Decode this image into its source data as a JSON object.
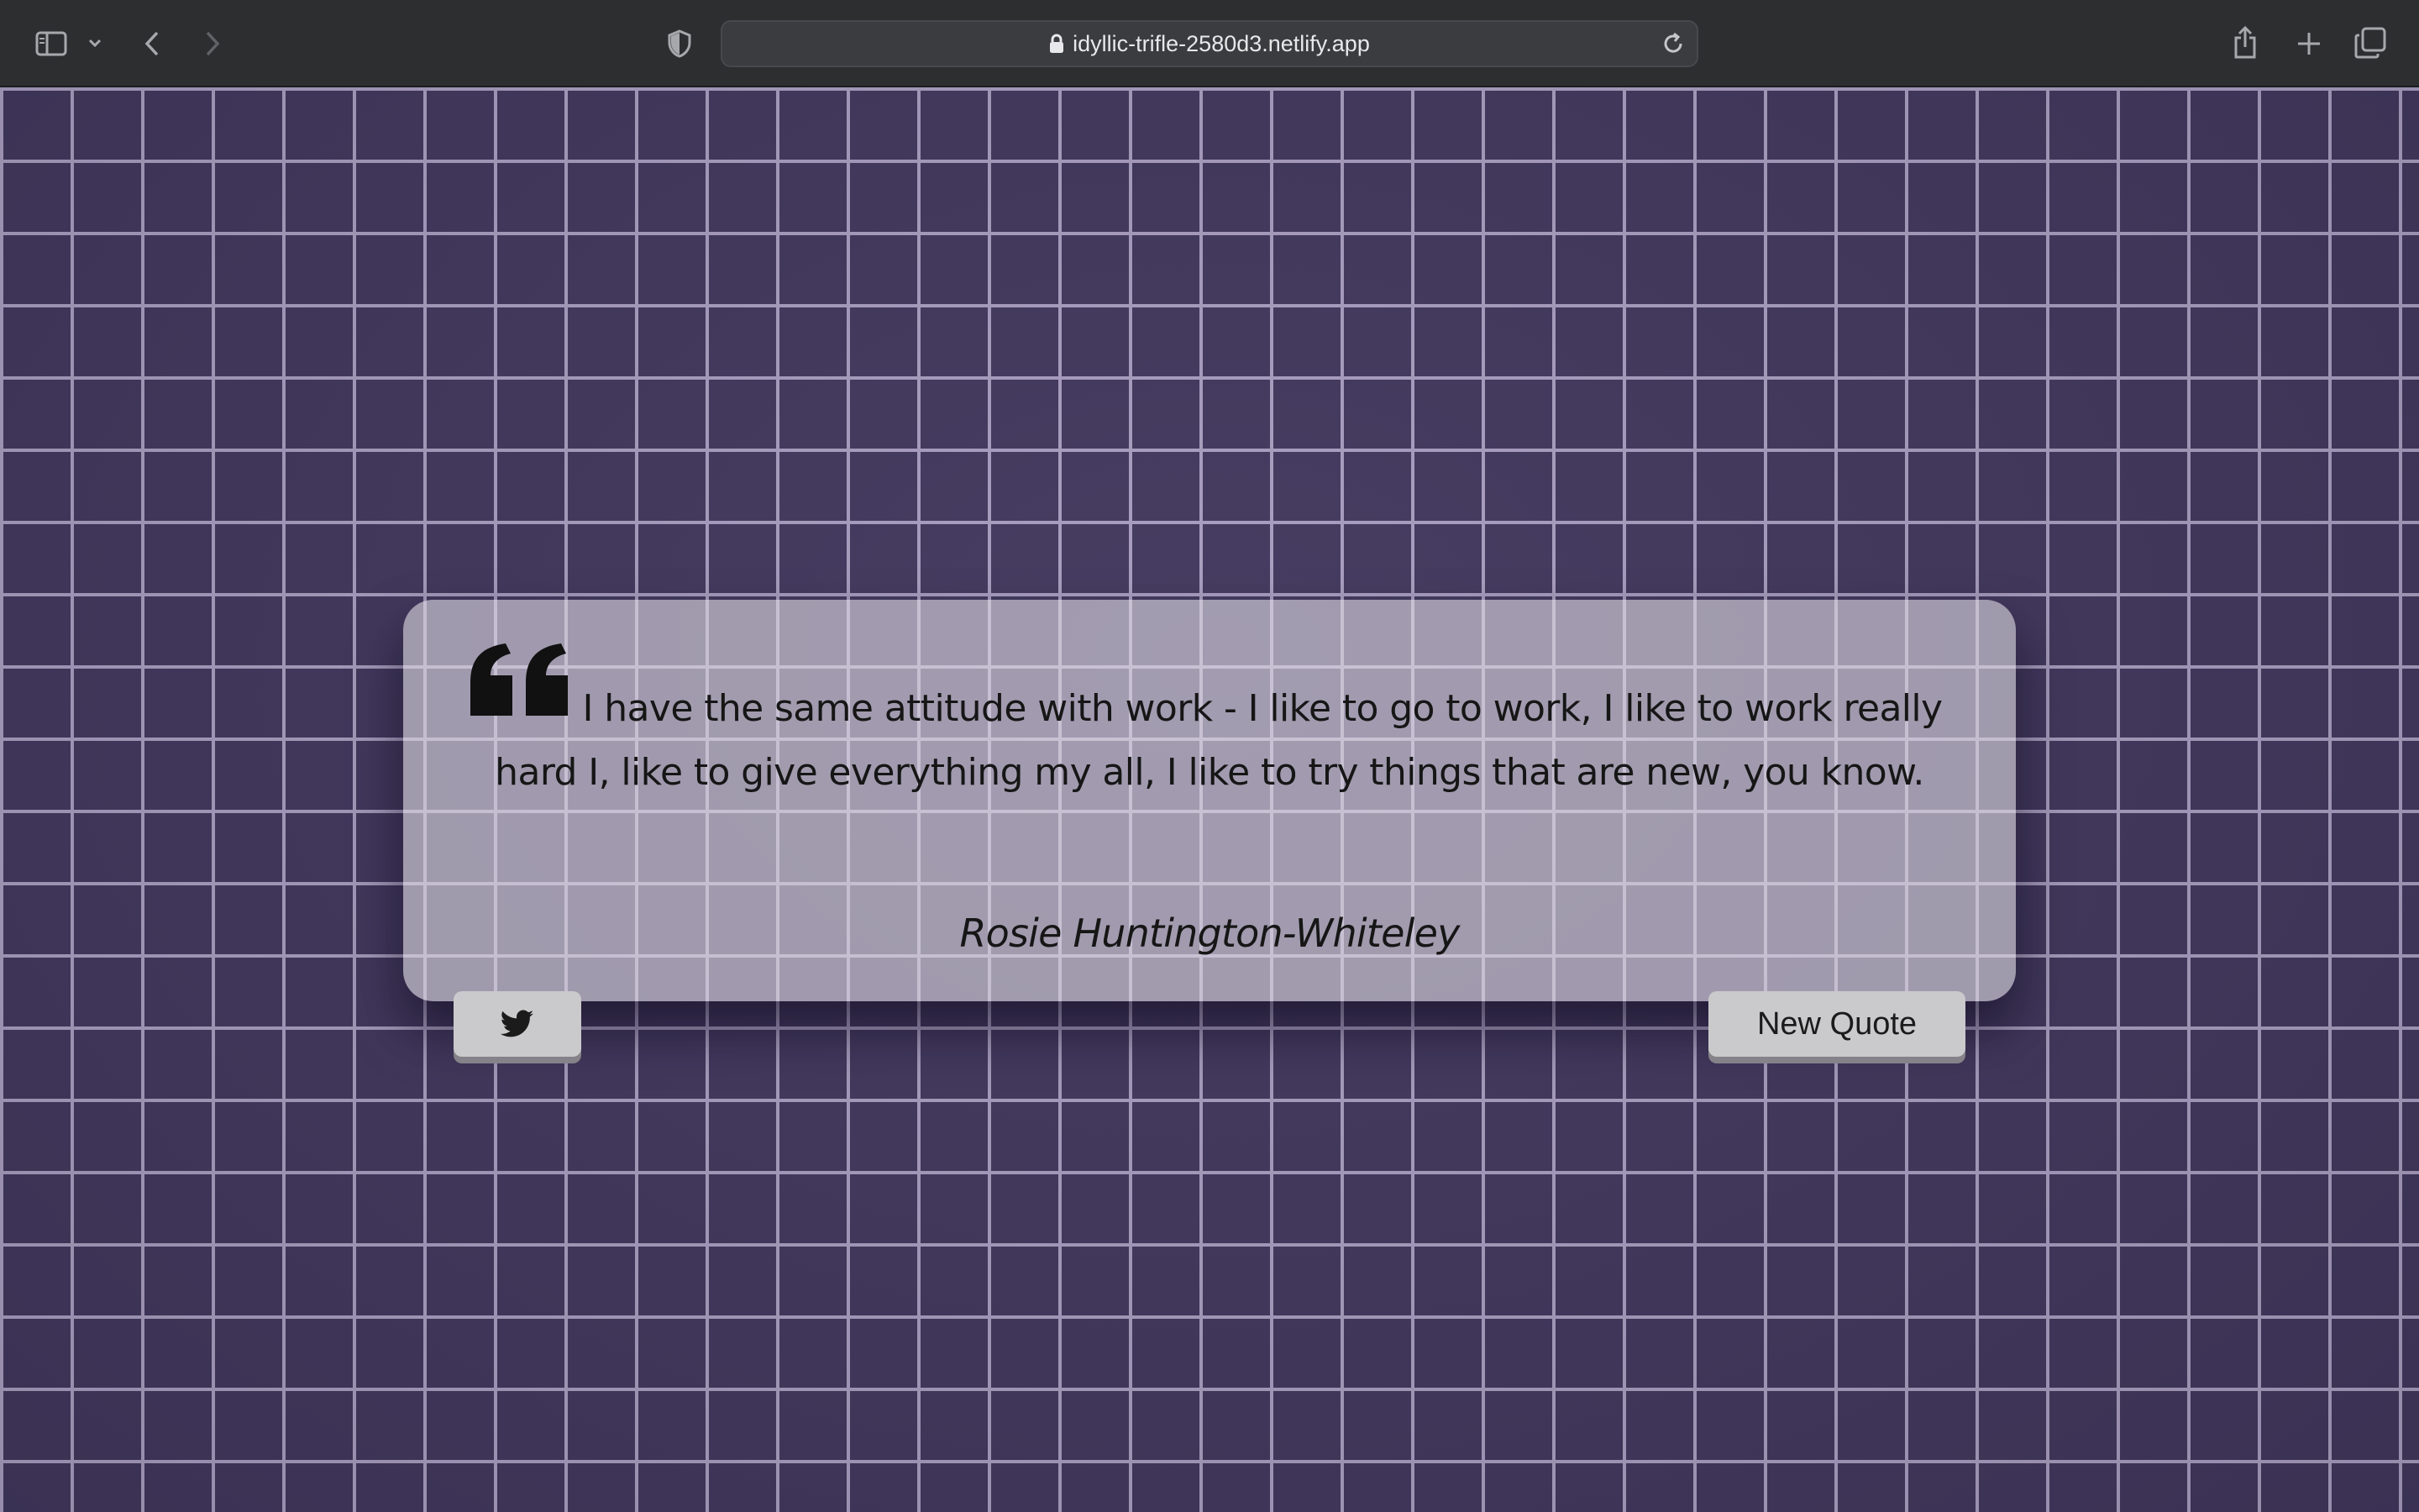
{
  "browser": {
    "url": "idyllic-trifle-2580d3.netlify.app",
    "icons": {
      "sidebar": "sidebar-icon",
      "sidebar_menu": "chevron-down-icon",
      "back": "chevron-left-icon",
      "forward": "chevron-right-icon",
      "privacy": "shield-icon",
      "lock": "lock-icon",
      "reload": "reload-icon",
      "share": "share-icon",
      "new_tab": "plus-icon",
      "tab_overview": "tabs-icon"
    }
  },
  "quote": {
    "text": "I have the same attitude with work - I like to go to work, I like to work really hard I, like to give everything my all, I like to try things that are new, you know.",
    "author": "Rosie Huntington-Whiteley",
    "icon": "quote-left-icon"
  },
  "actions": {
    "tweet_icon": "twitter-icon",
    "new_quote_label": "New Quote"
  },
  "colors": {
    "background": "#41375d",
    "mortar": "#a79cbe",
    "card": "#dcd7e1",
    "button": "#cac9cb",
    "text": "#161616"
  }
}
